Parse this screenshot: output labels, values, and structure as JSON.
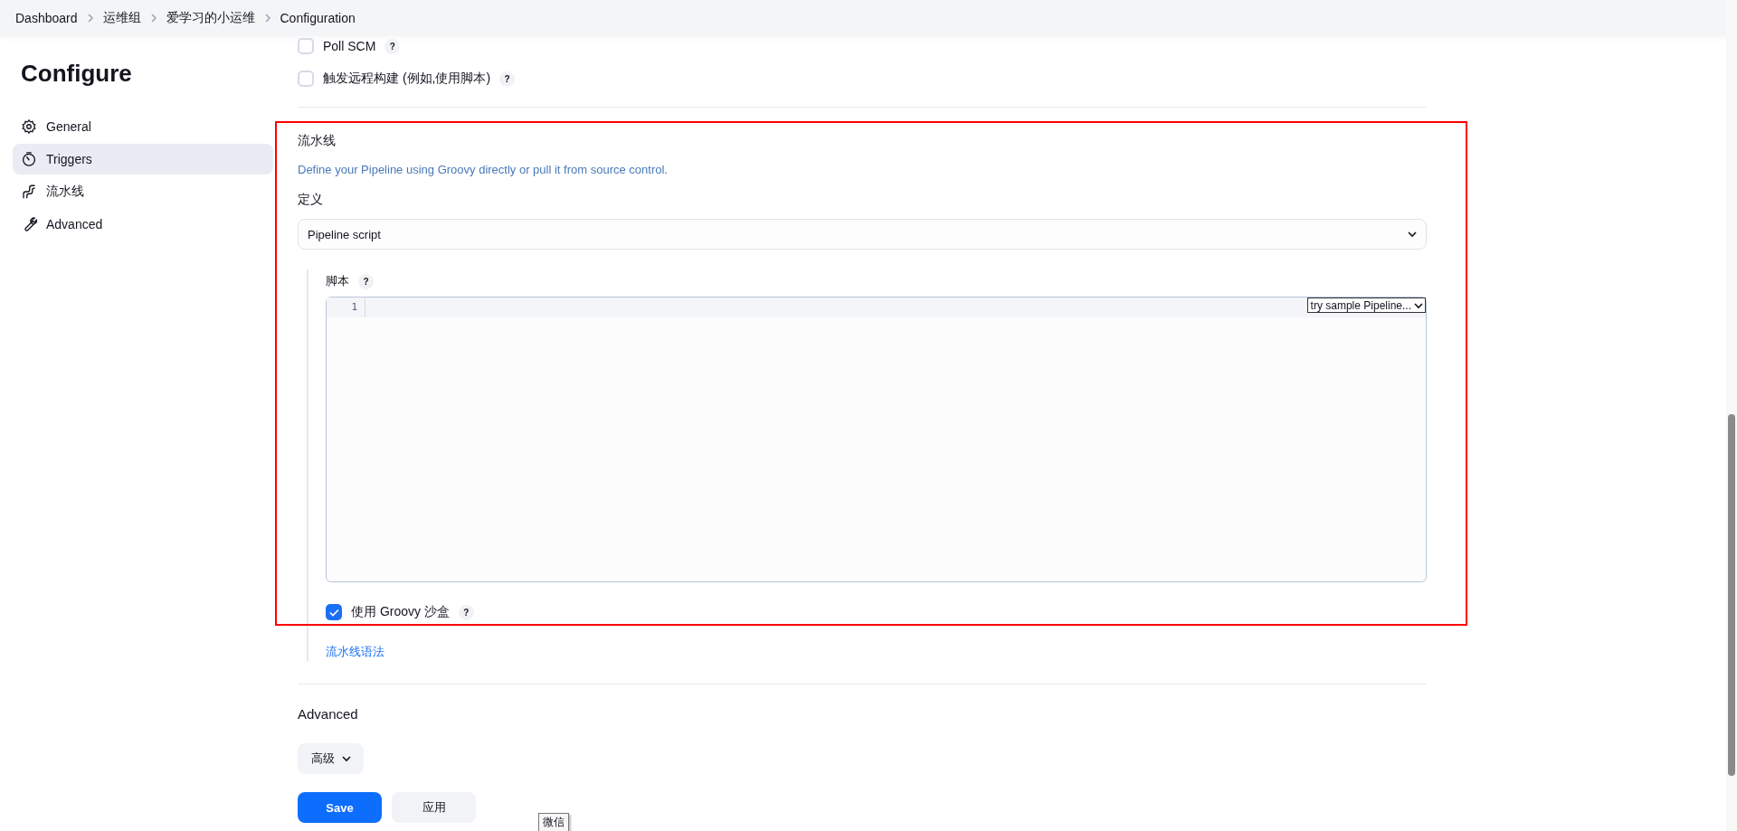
{
  "breadcrumbs": [
    "Dashboard",
    "运维组",
    "爱学习的小运维",
    "Configuration"
  ],
  "sidebar": {
    "title": "Configure",
    "items": [
      {
        "label": "General",
        "selected": false
      },
      {
        "label": "Triggers",
        "selected": true
      },
      {
        "label": "流水线",
        "selected": false
      },
      {
        "label": "Advanced",
        "selected": false
      }
    ]
  },
  "triggers": [
    {
      "label": "Poll SCM",
      "checked": false,
      "help": "?"
    },
    {
      "label": "触发远程构建 (例如,使用脚本)",
      "checked": false,
      "help": "?"
    }
  ],
  "pipeline": {
    "title": "流水线",
    "description": "Define your Pipeline using Groovy directly or pull it from source control.",
    "definition_label": "定义",
    "definition": "Pipeline script",
    "script": {
      "label": "脚本",
      "help": "?",
      "line_numbers": [
        "1"
      ],
      "sample_select": "try sample Pipeline..."
    },
    "sandbox": {
      "label": "使用 Groovy 沙盒",
      "checked": true,
      "help": "?"
    },
    "syntax_link": "流水线语法"
  },
  "advanced": {
    "title": "Advanced",
    "button": "高级"
  },
  "buttons": [
    {
      "label": "Save",
      "kind": "primary"
    },
    {
      "label": "应用",
      "kind": "secondary"
    }
  ],
  "tooltip": "微信"
}
